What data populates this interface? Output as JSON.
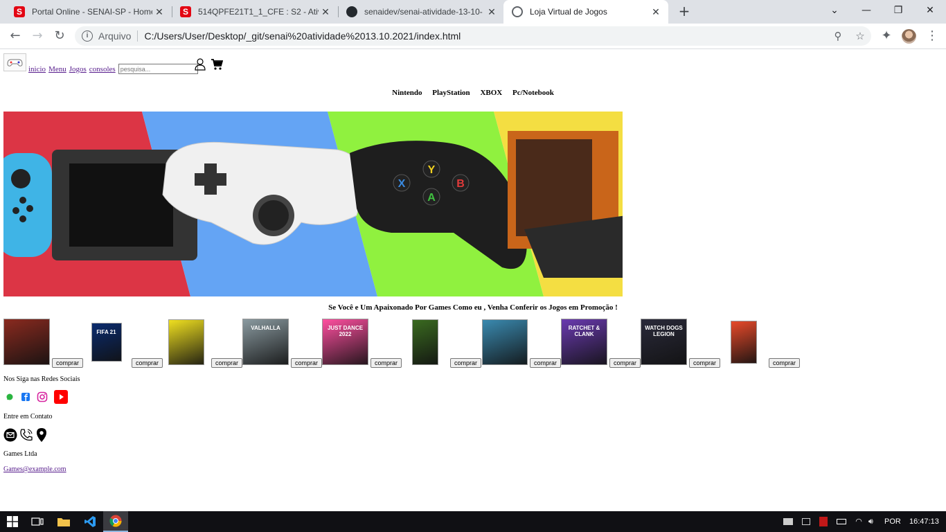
{
  "browser": {
    "tabs": [
      {
        "title": "Portal Online - SENAI-SP - Home",
        "favicon": "senai-icon"
      },
      {
        "title": "514QPFE21T1_1_CFE : S2 - Ativid",
        "favicon": "senai-icon"
      },
      {
        "title": "senaidev/senai-atividade-13-10-",
        "favicon": "github-icon"
      },
      {
        "title": "Loja Virtual de Jogos",
        "favicon": "globe-icon"
      }
    ],
    "address": {
      "scheme": "Arquivo",
      "url": "C:/Users/User/Desktop/_git/senai%20atividade%2013.10.2021/index.html"
    }
  },
  "header": {
    "nav": [
      "inicio",
      "Menu",
      "Jogos",
      "consoles"
    ],
    "search_placeholder": "pesquisa..."
  },
  "platforms": [
    "Nintendo",
    "PlayStation",
    "XBOX",
    "Pc/Notebook"
  ],
  "banner": {
    "colors": [
      "#dc3545",
      "#64a4f4",
      "#90f13f",
      "#f4de42"
    ],
    "labels": [
      "Y",
      "X",
      "B",
      "A"
    ]
  },
  "promo_text": "Se Você e Um Apaixonado Por Games Como eu , Venha Conferir os Jogos em Promoção !",
  "products": [
    {
      "name": "game-cover-battlefield",
      "button": "comprar",
      "color": "#8a2a1f"
    },
    {
      "name": "game-cover-fifa21",
      "button": "comprar",
      "color": "#0a2b6e",
      "cover_text": "FIFA 21"
    },
    {
      "name": "game-cover-cyberpunk",
      "button": "comprar",
      "color": "#f0e020"
    },
    {
      "name": "game-cover-valhalla",
      "button": "comprar",
      "color": "#8a9aa0",
      "cover_text": "VALHALLA"
    },
    {
      "name": "game-cover-just-dance",
      "button": "comprar",
      "color": "#ff4fa0",
      "cover_text": "JUST DANCE 2022"
    },
    {
      "name": "game-cover-forza",
      "button": "comprar",
      "color": "#3a6a20"
    },
    {
      "name": "game-cover-horizon",
      "button": "comprar",
      "color": "#3a8ab0"
    },
    {
      "name": "game-cover-ratchet-clank",
      "button": "comprar",
      "color": "#6a3ab0",
      "cover_text": "RATCHET & CLANK"
    },
    {
      "name": "game-cover-watch-dogs",
      "button": "comprar",
      "color": "#2a2a3a",
      "cover_text": "WATCH DOGS LEGION"
    },
    {
      "name": "game-cover-mario-rabbids",
      "button": "comprar",
      "color": "#e84a2a"
    }
  ],
  "footer": {
    "social_title": "Nos Siga nas Redes Sociais",
    "contact_title": "Entre em Contato",
    "company": "Games Ltda",
    "email": "Games@example.com"
  },
  "taskbar": {
    "lang": "POR",
    "time": "16:47:13"
  }
}
